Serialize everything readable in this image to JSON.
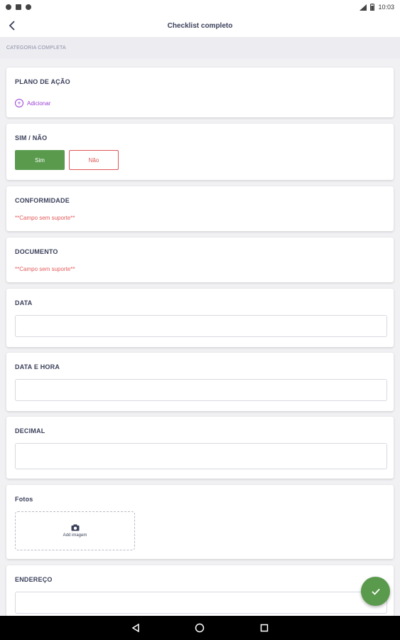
{
  "status_bar": {
    "time": "10:03"
  },
  "header": {
    "title": "Checklist completo"
  },
  "category": {
    "title": "CATEGORIA COMPLETA"
  },
  "action_plan": {
    "label": "PLANO DE AÇÃO",
    "add_label": "Adicionar"
  },
  "yes_no": {
    "label": "SIM / NÃO",
    "yes_label": "Sim",
    "no_label": "Não",
    "selected": "Sim"
  },
  "conformity": {
    "label": "CONFORMIDADE",
    "message": "**Campo sem suporte**"
  },
  "document": {
    "label": "DOCUMENTO",
    "message": "**Campo sem suporte**"
  },
  "date": {
    "label": "DATA",
    "value": ""
  },
  "datetime": {
    "label": "DATA E HORA",
    "value": ""
  },
  "decimal": {
    "label": "DECIMAL",
    "value": ""
  },
  "photos": {
    "label": "Fotos",
    "add_image_label": "Add imagem"
  },
  "address": {
    "label": "ENDEREÇO",
    "value": ""
  },
  "colors": {
    "accent_green": "#5a9a4d",
    "error_red": "#e05656",
    "link_purple": "#9b3fd6"
  }
}
